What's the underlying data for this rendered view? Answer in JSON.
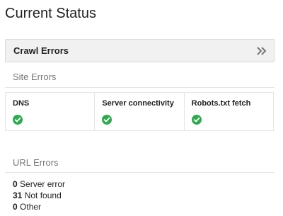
{
  "page": {
    "title": "Current Status"
  },
  "crawl_errors": {
    "label": "Crawl Errors",
    "expand_icon": "double-chevron-right-icon"
  },
  "site_errors": {
    "label": "Site Errors",
    "items": [
      {
        "label": "DNS",
        "status_icon": "check-circle-icon",
        "status_color": "#2eaa4f"
      },
      {
        "label": "Server connectivity",
        "status_icon": "check-circle-icon",
        "status_color": "#2eaa4f"
      },
      {
        "label": "Robots.txt fetch",
        "status_icon": "check-circle-icon",
        "status_color": "#2eaa4f"
      }
    ]
  },
  "url_errors": {
    "label": "URL Errors",
    "items": [
      {
        "count": "0",
        "label": "Server error"
      },
      {
        "count": "31",
        "label": "Not found"
      },
      {
        "count": "0",
        "label": "Other"
      }
    ]
  }
}
